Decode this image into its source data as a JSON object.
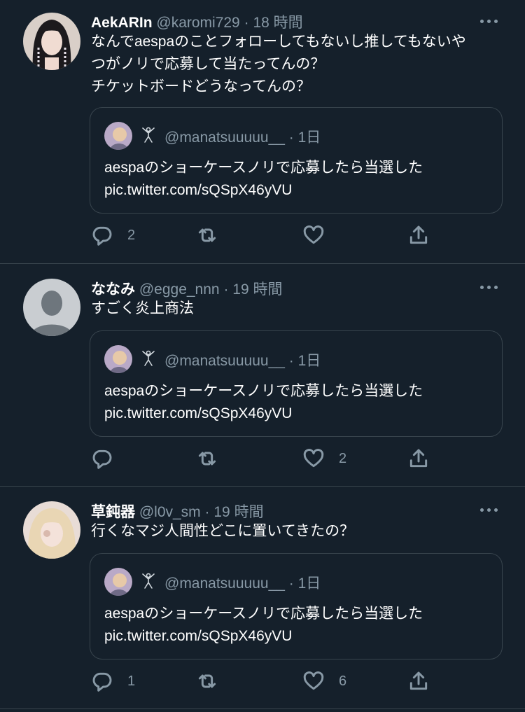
{
  "tweets": [
    {
      "name": "AekARIn",
      "handle": "@karomi729",
      "dot": "·",
      "time": "18 時間",
      "lines": [
        "なんでaespaのことフォローしてもないし推してもないや",
        "つがノリで応募して当たってんの？",
        "チケットボードどうなってんの？"
      ],
      "quote": {
        "handle": "@manatsuuuuu__",
        "dot": "·",
        "time": "1日",
        "lines": [
          "aespaのショーケースノリで応募したら当選した",
          "pic.twitter.com/sQSpX46yVU"
        ]
      },
      "replies": "2",
      "retweets": "",
      "likes": "",
      "avatar": "photo-woman-braids"
    },
    {
      "name": "ななみ",
      "handle": "@egge_nnn",
      "dot": "·",
      "time": "19 時間",
      "lines": [
        "すごく炎上商法"
      ],
      "quote": {
        "handle": "@manatsuuuuu__",
        "dot": "·",
        "time": "1日",
        "lines": [
          "aespaのショーケースノリで応募したら当選した",
          "pic.twitter.com/sQSpX46yVU"
        ]
      },
      "replies": "",
      "retweets": "",
      "likes": "2",
      "avatar": "default-profile"
    },
    {
      "name": "草鈍器",
      "handle": "@l0v_sm",
      "dot": "·",
      "time": "19 時間",
      "lines": [
        "行くなマジ人間性どこに置いてきたの？"
      ],
      "quote": {
        "handle": "@manatsuuuuu__",
        "dot": "·",
        "time": "1日",
        "lines": [
          "aespaのショーケースノリで応募したら当選した",
          "pic.twitter.com/sQSpX46yVU"
        ]
      },
      "replies": "1",
      "retweets": "",
      "likes": "6",
      "avatar": "photo-blonde"
    }
  ],
  "colors": {
    "background": "#15202b",
    "border": "#38444d",
    "secondary_text": "#8899a6",
    "primary_text": "#ffffff"
  },
  "icons": [
    "reply-icon",
    "retweet-icon",
    "like-icon",
    "share-icon",
    "more-icon",
    "dancer-emoji-icon"
  ]
}
